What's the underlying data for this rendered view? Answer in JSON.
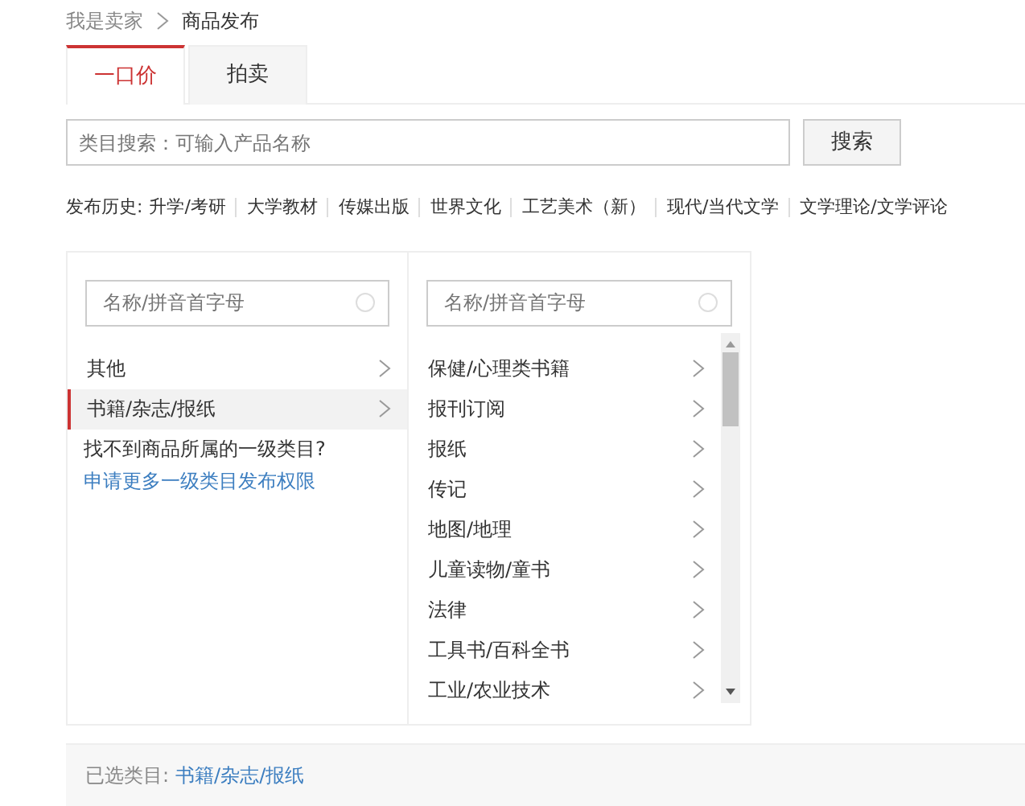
{
  "breadcrumb": [
    "我是卖家",
    "商品发布"
  ],
  "tabs": [
    {
      "label": "一口价",
      "selected": true
    },
    {
      "label": "拍卖",
      "selected": false
    }
  ],
  "search": {
    "placeholder": "类目搜索：可输入产品名称",
    "button": "搜索"
  },
  "history": {
    "label": "发布历史:",
    "items": [
      "升学/考研",
      "大学教材",
      "传媒出版",
      "世界文化",
      "工艺美术（新）",
      "现代/当代文学",
      "文学理论/文学评论"
    ]
  },
  "columns": [
    {
      "placeholder": "名称/拼音首字母",
      "items": [
        {
          "label": "其他",
          "selected": false
        },
        {
          "label": "书籍/杂志/报纸",
          "selected": true
        }
      ],
      "note": "找不到商品所属的一级类目?",
      "note_link": "申请更多一级类目发布权限"
    },
    {
      "placeholder": "名称/拼音首字母",
      "items": [
        {
          "label": "保健/心理类书籍",
          "selected": false
        },
        {
          "label": "报刊订阅",
          "selected": false
        },
        {
          "label": "报纸",
          "selected": false
        },
        {
          "label": "传记",
          "selected": false
        },
        {
          "label": "地图/地理",
          "selected": false
        },
        {
          "label": "儿童读物/童书",
          "selected": false
        },
        {
          "label": "法律",
          "selected": false
        },
        {
          "label": "工具书/百科全书",
          "selected": false
        },
        {
          "label": "工业/农业技术",
          "selected": false
        }
      ]
    }
  ],
  "selected_category": {
    "label": "已选类目:",
    "value": "书籍/杂志/报纸"
  }
}
